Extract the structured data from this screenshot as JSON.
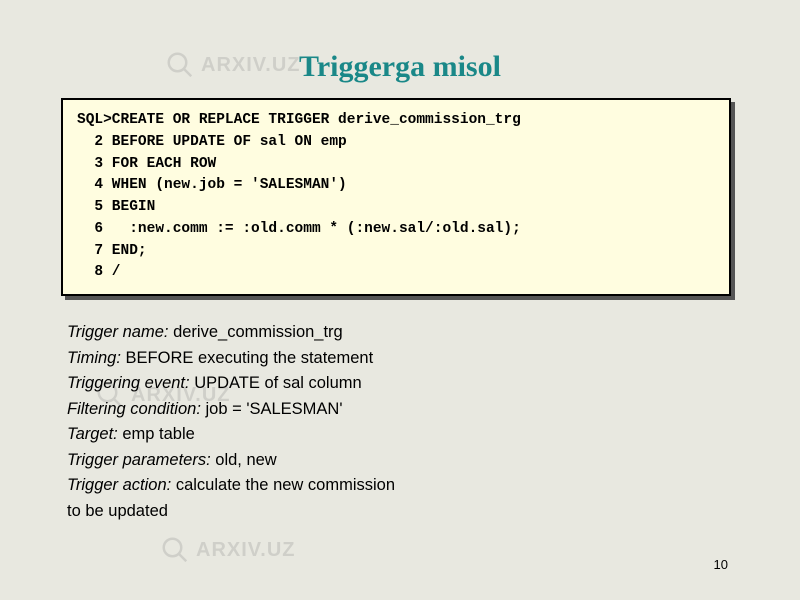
{
  "title": "Triggerga misol",
  "code": {
    "line1": "SQL>CREATE OR REPLACE TRIGGER derive_commission_trg",
    "line2": "  2 BEFORE UPDATE OF sal ON emp",
    "line3": "  3 FOR EACH ROW",
    "line4": "  4 WHEN (new.job = 'SALESMAN')",
    "line5": "  5 BEGIN",
    "line6": "  6   :new.comm := :old.comm * (:new.sal/:old.sal);",
    "line7": "  7 END;",
    "line8": "  8 /"
  },
  "description": {
    "row1": {
      "label": "Trigger name:",
      "value": "derive_commission_trg"
    },
    "row2": {
      "label": "Timing:",
      "value": "BEFORE executing the statement"
    },
    "row3": {
      "label": "Triggering event:",
      "value": "UPDATE of sal column"
    },
    "row4": {
      "label": "Filtering condition:",
      "value": "job = 'SALESMAN'"
    },
    "row5": {
      "label": "Target:",
      "value": "emp table"
    },
    "row6": {
      "label": "Trigger parameters:",
      "value": "old, new"
    },
    "row7": {
      "label": "Trigger action:",
      "value": "calculate the new commission"
    },
    "row8": {
      "label": "",
      "value": "to be updated"
    }
  },
  "page_number": "10",
  "watermark_text": "ARXIV.UZ"
}
